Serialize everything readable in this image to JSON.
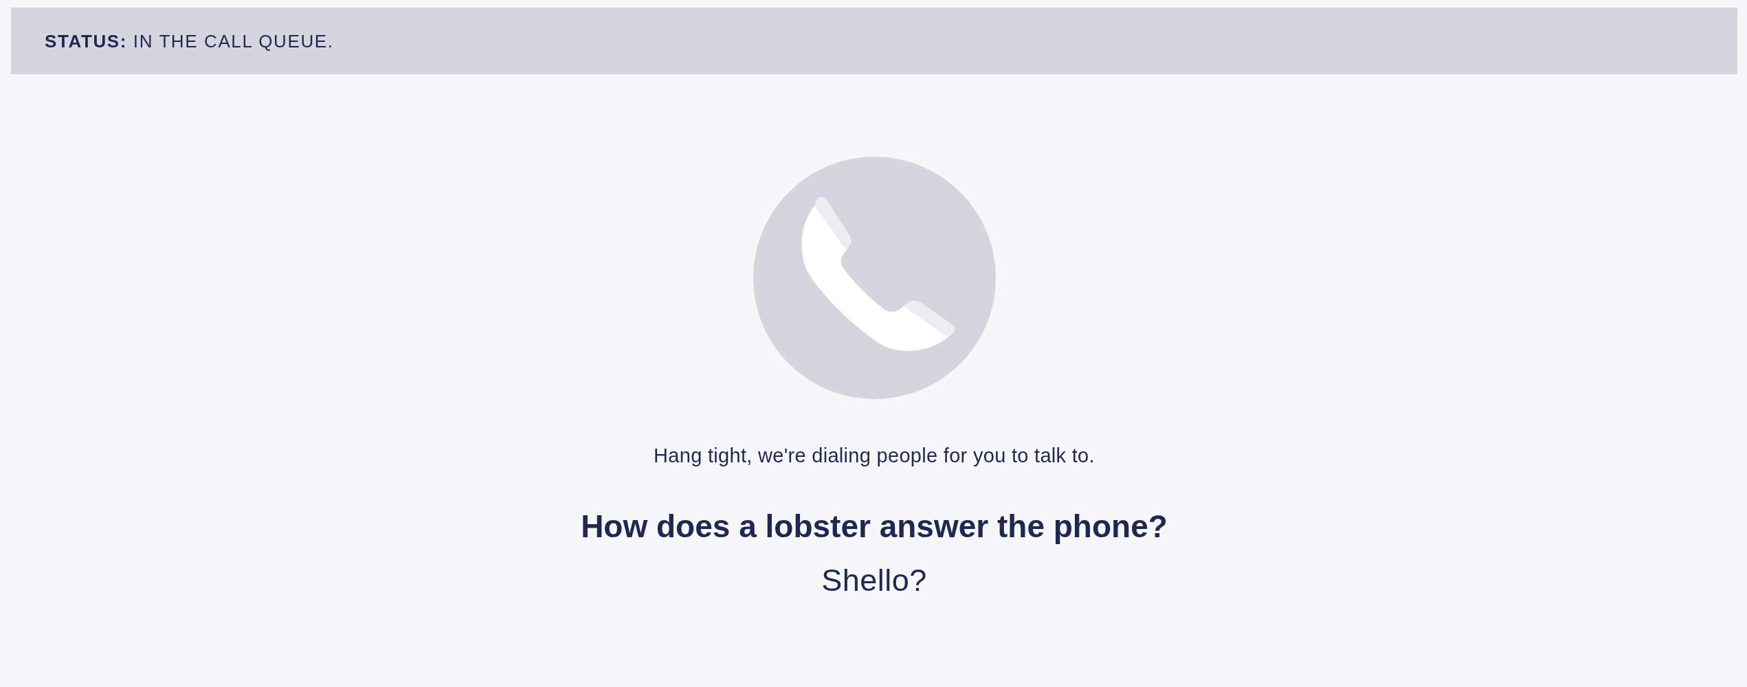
{
  "status_bar": {
    "text": "**STATUS:** IN THE CALL QUEUE."
  },
  "queue": {
    "message": "Hang tight, we're dialing people for you to talk to.",
    "joke": {
      "question": "How does a lobster answer the phone?",
      "answer": "Shello?"
    }
  }
}
